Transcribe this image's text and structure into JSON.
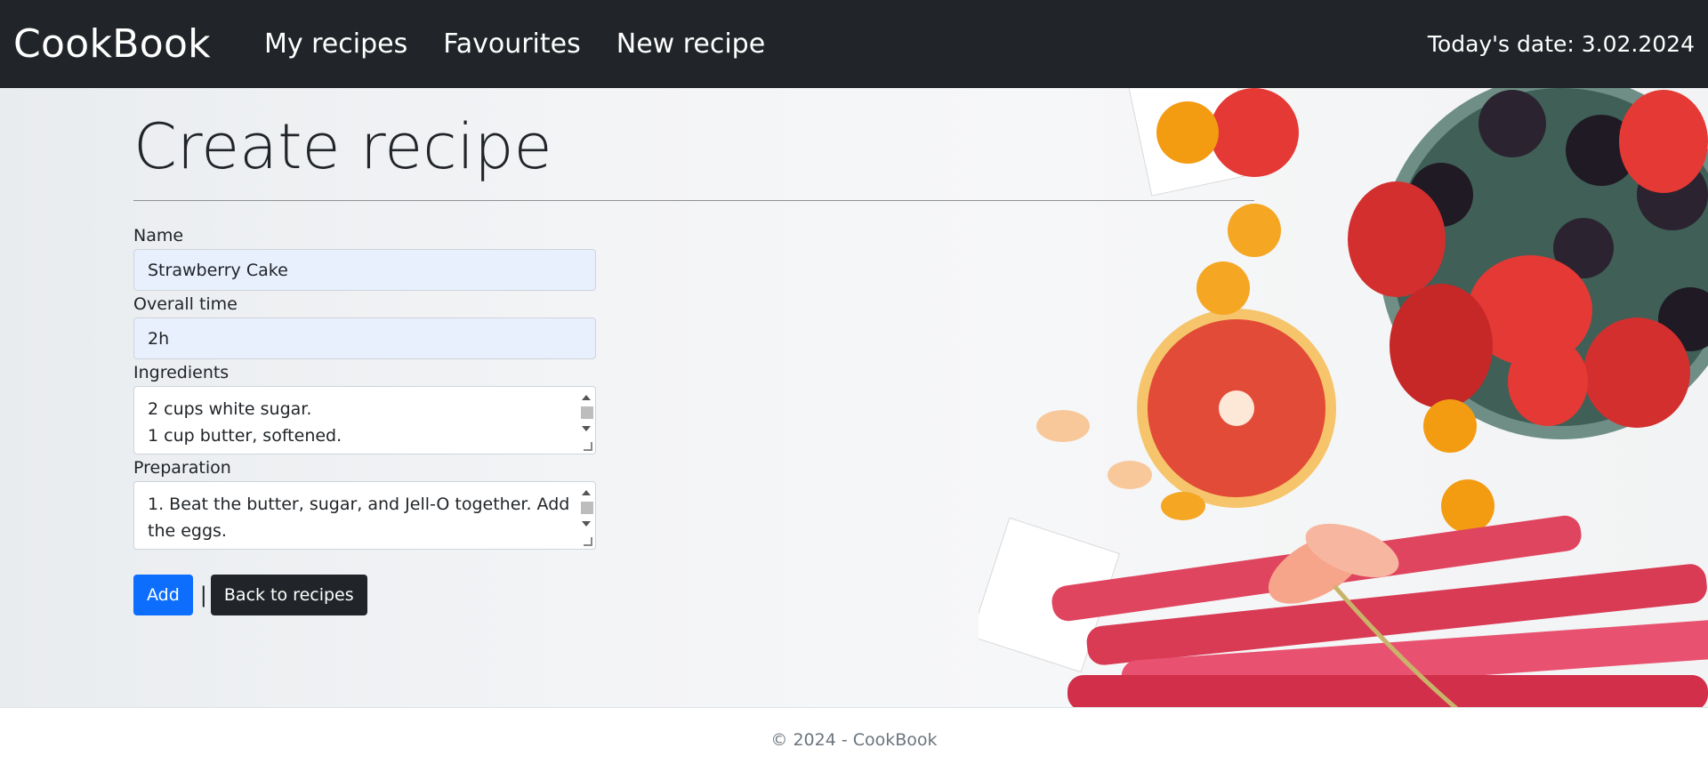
{
  "navbar": {
    "brand": "CookBook",
    "links": [
      "My recipes",
      "Favourites",
      "New recipe"
    ],
    "date_text": "Today's date: 3.02.2024"
  },
  "page": {
    "title": "Create recipe"
  },
  "form": {
    "name_label": "Name",
    "name_value": "Strawberry Cake",
    "time_label": "Overall time",
    "time_value": "2h",
    "ingredients_label": "Ingredients",
    "ingredients_lines": [
      "2 cups white sugar.",
      "1 cup butter, softened."
    ],
    "preparation_label": "Preparation",
    "preparation_line1": "1. Beat the butter, sugar, and Jell-O together. Add",
    "preparation_line2": "the eggs."
  },
  "actions": {
    "add_label": "Add",
    "separator": "|",
    "back_label": "Back to recipes"
  },
  "footer": {
    "text": "© 2024 - CookBook"
  },
  "colors": {
    "navbar_bg": "#212529",
    "primary": "#0d6efd",
    "dark_button": "#212529",
    "input_autofill_bg": "#e8f0fe"
  }
}
